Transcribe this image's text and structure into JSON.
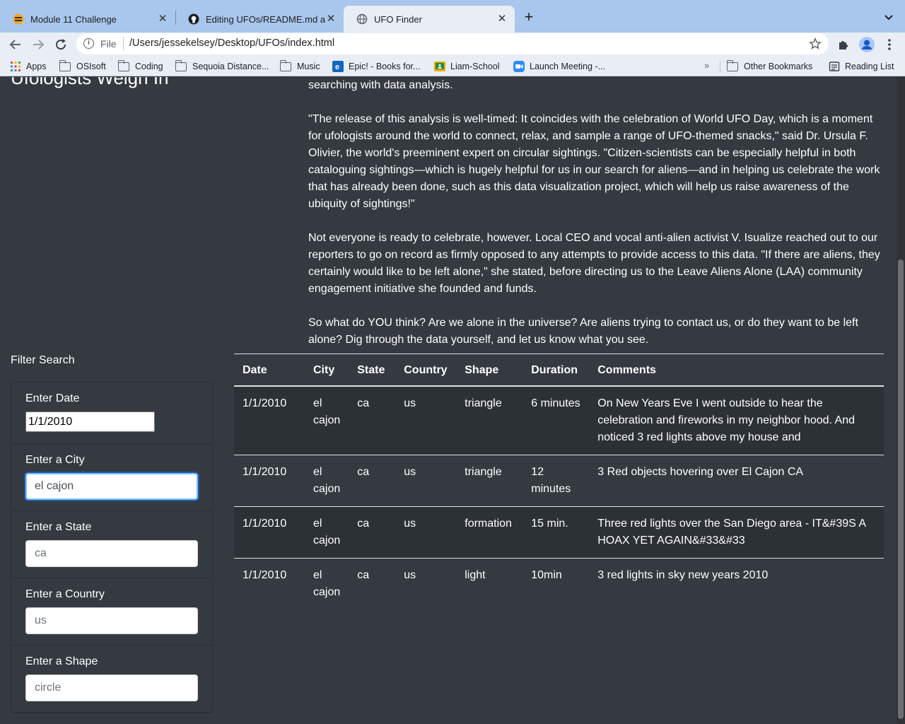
{
  "browser": {
    "tabs": [
      {
        "title": "Module 11 Challenge",
        "icon": "module-favicon-icon"
      },
      {
        "title": "Editing UFOs/README.md at m",
        "icon": "github-icon"
      },
      {
        "title": "UFO Finder",
        "icon": "globe-icon"
      }
    ],
    "close_glyph": "✕",
    "new_tab_glyph": "+",
    "address": {
      "scheme": "File",
      "url": "/Users/jessekelsey/Desktop/UFOs/index.html"
    },
    "bookmarks": [
      {
        "label": "Apps",
        "icon": "apps-grid-icon"
      },
      {
        "label": "OSIsoft",
        "icon": "folder-icon"
      },
      {
        "label": "Coding",
        "icon": "folder-icon"
      },
      {
        "label": "Sequoia Distance...",
        "icon": "folder-icon"
      },
      {
        "label": "Music",
        "icon": "folder-icon"
      },
      {
        "label": "Epic! - Books for...",
        "icon": "epic-icon"
      },
      {
        "label": "Liam-School",
        "icon": "classroom-icon"
      },
      {
        "label": "Launch Meeting -...",
        "icon": "zoom-icon"
      },
      {
        "label": "Other Bookmarks",
        "icon": "folder-icon"
      },
      {
        "label": "Reading List",
        "icon": "reading-list-icon"
      }
    ]
  },
  "page": {
    "heading_partial": "Ufologists Weigh In",
    "article": [
      "searching with data analysis.",
      "\"The release of this analysis is well-timed: It coincides with the celebration of World UFO Day, which is a moment for ufologists around the world to connect, relax, and sample a range of UFO-themed snacks,\" said Dr. Ursula F. Olivier, the world's preeminent expert on circular sightings. \"Citizen-scientists can be especially helpful in both cataloguing sightings—which is hugely helpful for us in our search for aliens—and in helping us celebrate the work that has already been done, such as this data visualization project, which will help us raise awareness of the ubiquity of sightings!\"",
      "Not everyone is ready to celebrate, however. Local CEO and vocal anti-alien activist V. Isualize reached out to our reporters to go on record as firmly opposed to any attempts to provide access to this data. \"If there are aliens, they certainly would like to be left alone,\" she stated, before directing us to the Leave Aliens Alone (LAA) community engagement initiative she founded and funds.",
      "So what do YOU think? Are we alone in the universe? Are aliens trying to contact us, or do they want to be left alone? Dig through the data yourself, and let us know what you see."
    ],
    "filter": {
      "title": "Filter Search",
      "date": {
        "label": "Enter Date",
        "value": "1/1/2010"
      },
      "city": {
        "label": "Enter a City",
        "value": "el cajon"
      },
      "state": {
        "label": "Enter a State",
        "placeholder": "ca"
      },
      "country": {
        "label": "Enter a Country",
        "placeholder": "us"
      },
      "shape": {
        "label": "Enter a Shape",
        "placeholder": "circle"
      }
    },
    "table": {
      "headers": [
        "Date",
        "City",
        "State",
        "Country",
        "Shape",
        "Duration",
        "Comments"
      ],
      "rows": [
        [
          "1/1/2010",
          "el cajon",
          "ca",
          "us",
          "triangle",
          "6 minutes",
          "On New Years Eve I went outside to hear the celebration and fireworks in my neighbor hood. And noticed 3 red lights above my house and"
        ],
        [
          "1/1/2010",
          "el cajon",
          "ca",
          "us",
          "triangle",
          "12 minutes",
          "3 Red objects hovering over El Cajon CA"
        ],
        [
          "1/1/2010",
          "el cajon",
          "ca",
          "us",
          "formation",
          "15 min.",
          "Three red lights over the San Diego area - IT&#39S A HOAX YET AGAIN&#33&#33"
        ],
        [
          "1/1/2010",
          "el cajon",
          "ca",
          "us",
          "light",
          "10min",
          "3 red lights in sky new years 2010"
        ]
      ]
    }
  }
}
